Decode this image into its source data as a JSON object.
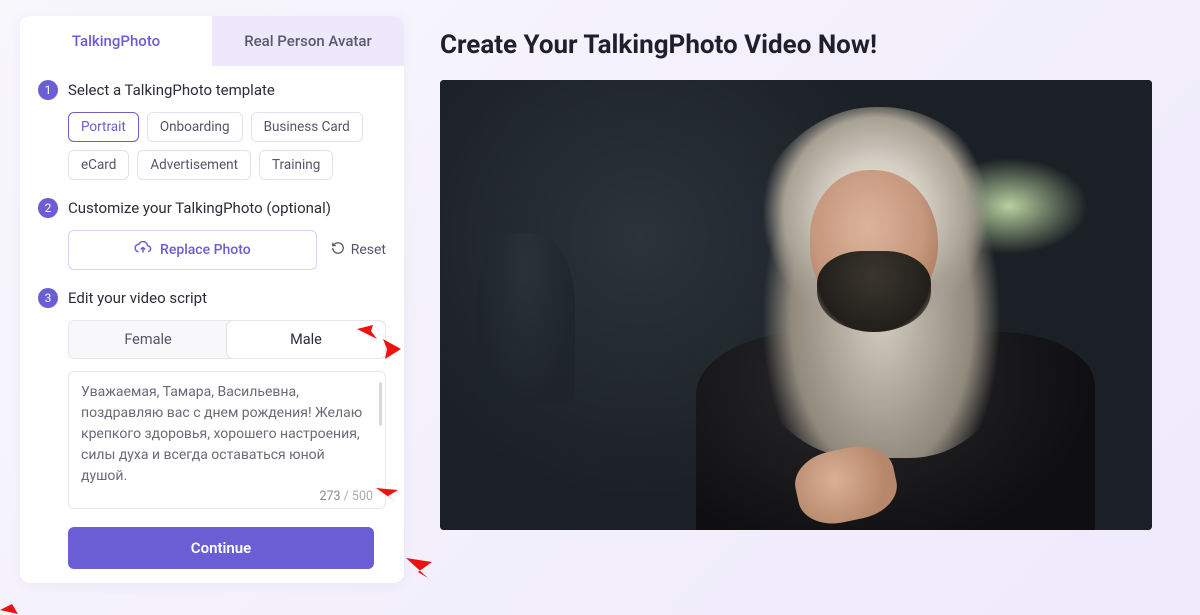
{
  "tabs": {
    "talking_photo": "TalkingPhoto",
    "real_person": "Real Person Avatar"
  },
  "steps": {
    "n1": "1",
    "n2": "2",
    "n3": "3",
    "t1": "Select a TalkingPhoto template",
    "t2": "Customize your TalkingPhoto (optional)",
    "t3": "Edit your video script"
  },
  "templates": {
    "portrait": "Portrait",
    "onboarding": "Onboarding",
    "business_card": "Business Card",
    "ecard": "eCard",
    "advertisement": "Advertisement",
    "training": "Training"
  },
  "customize": {
    "replace": "Replace Photo",
    "reset": "Reset"
  },
  "gender": {
    "female": "Female",
    "male": "Male"
  },
  "script": {
    "text": "Уважаемая, Тамара, Васильевна, поздравляю вас с днем рождения! Желаю крепкого здоровья, хорошего настроения, силы духа и всегда оставаться юной душой.",
    "count": "273",
    "sep": " / ",
    "max": "500"
  },
  "continue_label": "Continue",
  "headline": "Create Your TalkingPhoto Video Now!"
}
